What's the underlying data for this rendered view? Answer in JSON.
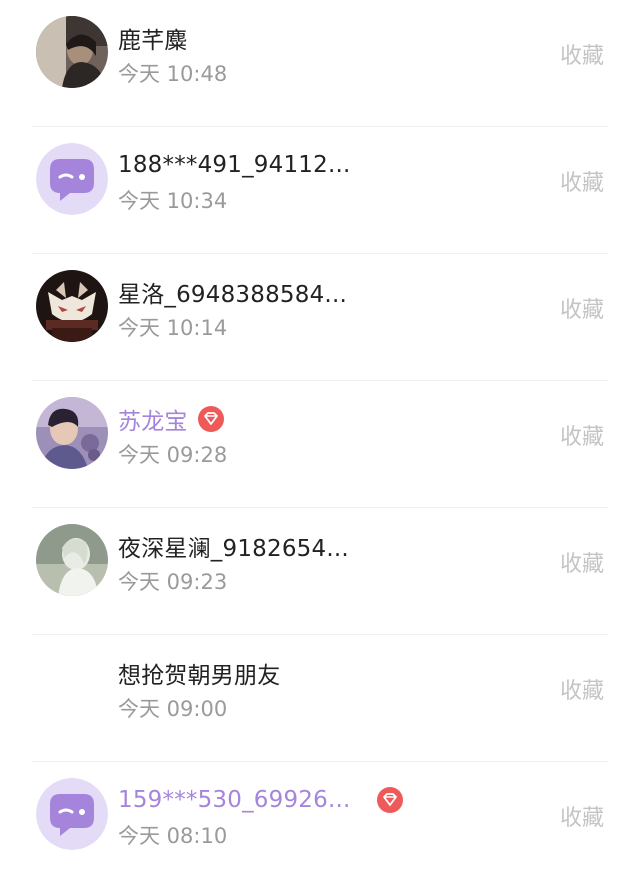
{
  "list": {
    "items": [
      {
        "name": "鹿芊麋",
        "time": "今天 10:48",
        "action": "收藏",
        "avatar": "photo-person-icon",
        "vip": false
      },
      {
        "name": "188***491_94112...",
        "time": "今天 10:34",
        "action": "收藏",
        "avatar": "default-chat-bubble-icon",
        "vip": false
      },
      {
        "name": "星洛_6948388584...",
        "time": "今天 10:14",
        "action": "收藏",
        "avatar": "photo-fox-mask-icon",
        "vip": false
      },
      {
        "name": "苏龙宝",
        "time": "今天 09:28",
        "action": "收藏",
        "avatar": "photo-person-icon",
        "vip": true
      },
      {
        "name": "夜深星澜_9182654...",
        "time": "今天 09:23",
        "action": "收藏",
        "avatar": "photo-pale-figure-icon",
        "vip": false
      },
      {
        "name": "想抢贺朝男朋友",
        "time": "今天 09:00",
        "action": "收藏",
        "avatar": "",
        "vip": false
      },
      {
        "name": "159***530_69926...",
        "time": "今天 08:10",
        "action": "收藏",
        "avatar": "default-chat-bubble-icon",
        "vip": true
      }
    ]
  },
  "colors": {
    "vip_name": "#a585dc",
    "badge": "#ee5a5a",
    "default_avatar_bg": "#e4dbf7",
    "default_avatar_bubble": "#a585dc"
  }
}
